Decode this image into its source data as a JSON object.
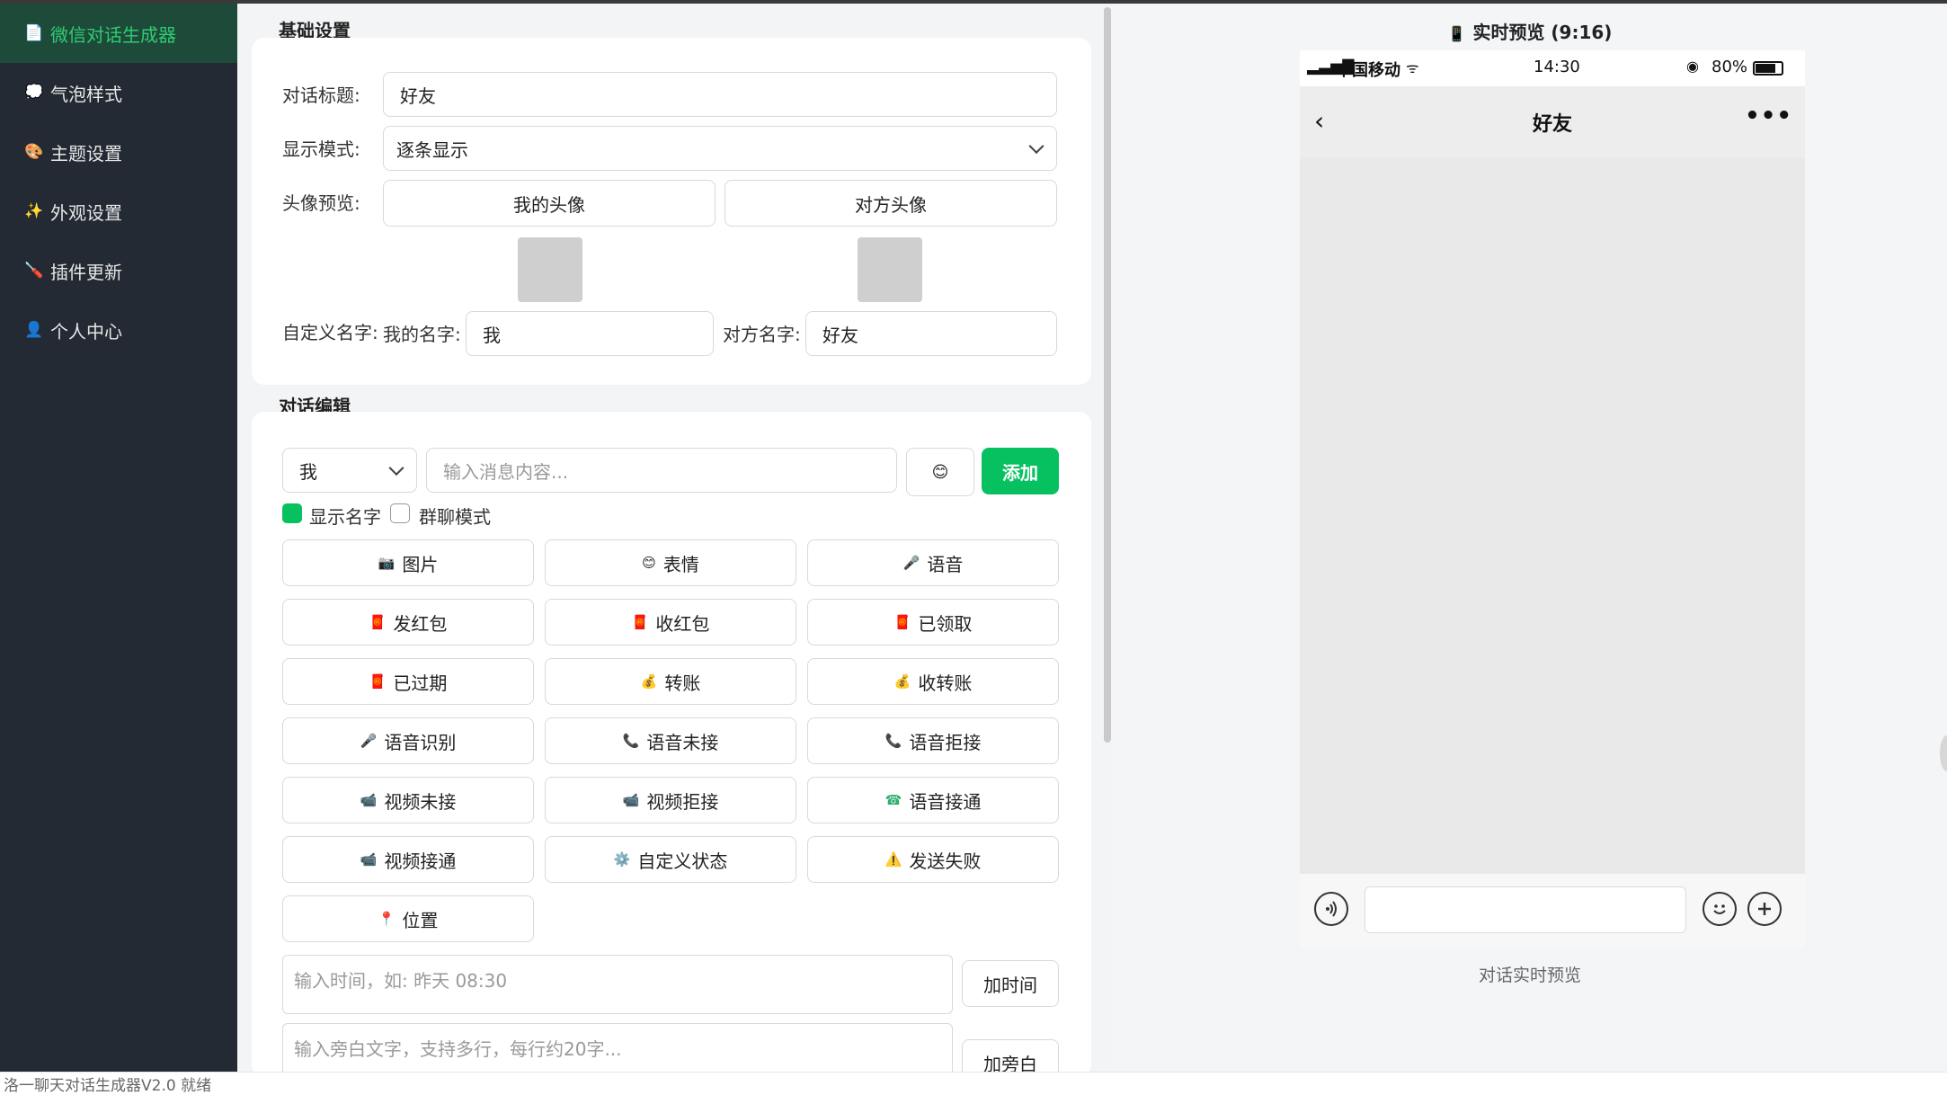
{
  "sidebar": {
    "items": [
      {
        "icon": "📄",
        "label": "微信对话生成器"
      },
      {
        "icon": "💭",
        "label": "气泡样式"
      },
      {
        "icon": "🎨",
        "label": "主题设置"
      },
      {
        "icon": "✨",
        "label": "外观设置"
      },
      {
        "icon": "🪛",
        "label": "插件更新"
      },
      {
        "icon": "👤",
        "label": "个人中心"
      }
    ]
  },
  "basic": {
    "section_title": "基础设置",
    "title_label": "对话标题:",
    "title_value": "好友",
    "mode_label": "显示模式:",
    "mode_value": "逐条显示",
    "avatar_label": "头像预览:",
    "my_avatar": "我的头像",
    "their_avatar": "对方头像",
    "custom_name_label": "自定义名字:",
    "my_name_label": "我的名字:",
    "my_name_value": "我",
    "their_name_label": "对方名字:",
    "their_name_value": "好友"
  },
  "dialog": {
    "section_title": "对话编辑",
    "sender_value": "我",
    "message_placeholder": "输入消息内容...",
    "emoji_icon": "😊",
    "add_label": "添加",
    "show_name_label": "显示名字",
    "group_mode_label": "群聊模式",
    "buttons": [
      {
        "icon": "📷",
        "label": "图片"
      },
      {
        "icon": "😊",
        "label": "表情"
      },
      {
        "icon": "🎤",
        "label": "语音"
      },
      {
        "icon": "🧧",
        "label": "发红包"
      },
      {
        "icon": "🧧",
        "label": "收红包"
      },
      {
        "icon": "🧧",
        "label": "已领取"
      },
      {
        "icon": "🧧",
        "label": "已过期"
      },
      {
        "icon": "💰",
        "label": "转账"
      },
      {
        "icon": "💰",
        "label": "收转账"
      },
      {
        "icon": "🎤",
        "label": "语音识别"
      },
      {
        "icon": "📞",
        "label": "语音未接"
      },
      {
        "icon": "📞",
        "label": "语音拒接"
      },
      {
        "icon": "📹",
        "label": "视频未接"
      },
      {
        "icon": "📹",
        "label": "视频拒接"
      },
      {
        "icon": "☎",
        "label": "语音接通"
      },
      {
        "icon": "📹",
        "label": "视频接通"
      },
      {
        "icon": "⚙️",
        "label": "自定义状态"
      },
      {
        "icon": "⚠️",
        "label": "发送失败"
      },
      {
        "icon": "📍",
        "label": "位置"
      }
    ],
    "time_placeholder": "输入时间，如: 昨天 08:30",
    "add_time_label": "加时间",
    "aside_placeholder": "输入旁白文字，支持多行，每行约20字...",
    "add_aside_label": "加旁白"
  },
  "preview": {
    "title_icon": "📱",
    "title": "实时预览 (9:16)",
    "carrier": "中国移动",
    "time": "14:30",
    "battery": "80%",
    "chat_title": "好友",
    "back_icon": "‹",
    "more_icon": "•••",
    "caption": "对话实时预览"
  },
  "statusbar": {
    "text": "洛一聊天对话生成器V2.0 就绪"
  },
  "colors": {
    "sidebar_bg": "#232a33",
    "accent_green": "#07c160",
    "active_text": "#2ecc71"
  }
}
